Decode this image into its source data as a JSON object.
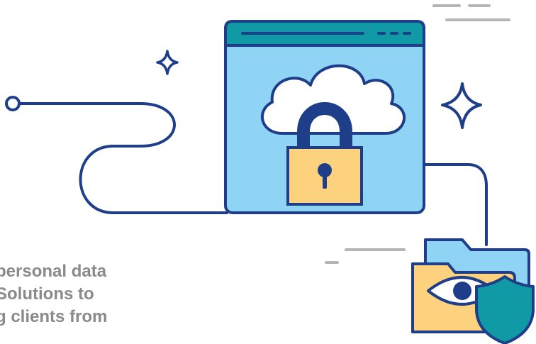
{
  "text": {
    "lines": [
      "personal data",
      "Solutions to",
      "g clients from"
    ]
  },
  "icons": {
    "window": "browser-window-icon",
    "cloud": "cloud-icon",
    "lock": "padlock-icon",
    "folder": "folder-icon",
    "eye": "eye-icon",
    "shield": "shield-icon",
    "sparkle": "sparkle-icon"
  },
  "colors": {
    "outline": "#1f3e8a",
    "window_bar": "#0f9aa6",
    "window_body": "#8fd3f5",
    "lock_body": "#fdd27f",
    "folder": "#fdd27f",
    "folder_back": "#8fd3f5",
    "shield": "#0f9aa6",
    "dash": "#b5b5b5",
    "text": "#8a8a8a"
  }
}
